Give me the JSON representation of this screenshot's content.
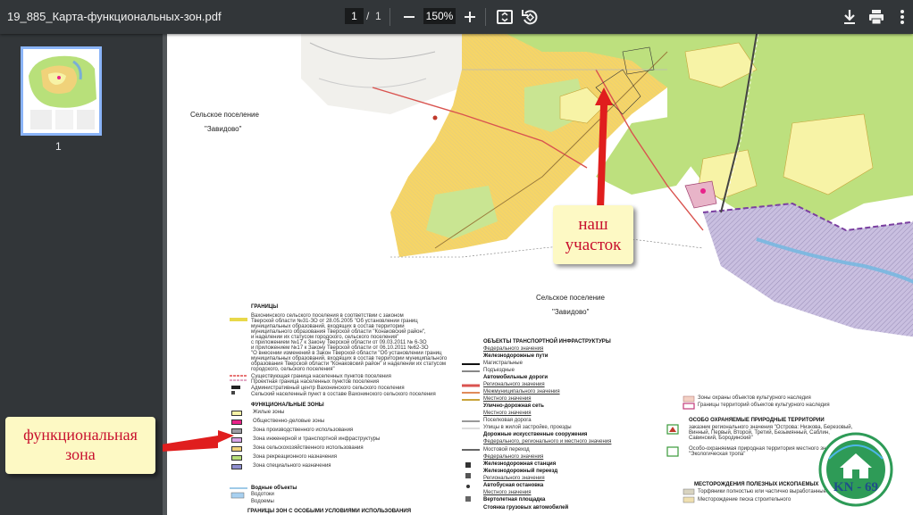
{
  "toolbar": {
    "title": "19_885_Карта-функциональных-зон.pdf",
    "page_current": "1",
    "page_separator": "/",
    "page_total": "1",
    "zoom": "150%"
  },
  "sidebar": {
    "thumb_page_number": "1"
  },
  "map": {
    "settlement_1_line1": "Сельское поселение",
    "settlement_1_line2": "\"Завидово\"",
    "settlement_2_line1": "Сельское поселение",
    "settlement_2_line2": "\"Завидово\""
  },
  "legend_left": {
    "granitsy_title": "ГРАНИЦЫ",
    "granitsy_text_1": "Вахонинского сельского поселения в соответствии с законом",
    "granitsy_text_2": "Тверской области №31-ЗО от 28.05.2005 \"Об установлении границ",
    "granitsy_text_3": "муниципальных образований, входящих в состав территории",
    "granitsy_text_4": "муниципального образования Тверской области \"Конаковский район\",",
    "granitsy_text_5": "и наделении их статусом городского, сельского поселения\"",
    "granitsy_text_6": "с приложением №17 к Закону Тверской области от 09.03.2011 № 6-ЗО",
    "granitsy_text_7": "и приложением №17 к Закону Тверской области от 06.10.2011 №62-ЗО",
    "granitsy_text_8": "\"О внесении изменений в Закон Тверской области \"Об установлении границ",
    "granitsy_text_9": "муниципальных образований, входящих в состав территории муниципального",
    "granitsy_text_10": "образования Тверской области \"Конаковский район\" и наделении их статусом",
    "granitsy_text_11": "городского, сельского поселения\"",
    "existing_border": "Существующая граница населенных пунктов поселения",
    "project_border": "Проектная граница населенных пунктов поселения",
    "admin_center": "Административный центр Вахонинского сельского поселения",
    "rural_settlement": "Сельский населенный пункт в составе Вахонинского сельского поселения",
    "zones_title": "ФУНКЦИОНАЛЬНЫЕ ЗОНЫ",
    "zones": [
      {
        "label": "Жилые зоны",
        "color": "#f7f3a6"
      },
      {
        "label": "Общественно-деловые зоны",
        "color": "#e8238a"
      },
      {
        "label": "Зона производственного использования",
        "color": "#9b9ba3"
      },
      {
        "label": "Зона инженерной и транспортной инфраструктуры",
        "color": "#d9a3e6"
      },
      {
        "label": "Зона сельскохозяйственного использования",
        "color": "#f0d27a"
      },
      {
        "label": "Зона рекреационного назначения",
        "color": "#b8e07a"
      },
      {
        "label": "Зона специального назначения",
        "color": "#8f8fd0"
      }
    ],
    "water_title": "Водные объекты",
    "water_1": "Водотоки",
    "water_2": "Водоемы",
    "special_zones_title": "ГРАНИЦЫ ЗОН С ОСОБЫМИ УСЛОВИЯМИ ИСПОЛЬЗОВАНИЯ"
  },
  "legend_mid": {
    "title": "ОБЪЕКТЫ ТРАНСПОРТНОЙ ИНФРАСТРУКТУРЫ",
    "federal": "Федерального значения",
    "rail_title": "Железнодорожные пути",
    "main_rail": "Магистральные",
    "access_rail": "Подъездные",
    "roads_title": "Автомобильные дороги",
    "regional": "Регионального значения",
    "intermunicipal": "Межмуниципального значения",
    "local": "Местного значения",
    "street_title": "Улично-дорожная сеть",
    "local2": "Местного значения",
    "main_road": "Поселковая дорога",
    "streets": "Улицы в жилой застройке, проезды",
    "bridges_title": "Дорожные искусственные сооружения",
    "bridges_level": "Федерального, регионального и местного значения",
    "bridge": "Мостовой переход",
    "federal2": "Федерального значения",
    "station": "Железнодорожная станция",
    "crossing": "Железнодорожный переезд",
    "regional2": "Регионального значения",
    "bus": "Автобусная остановка",
    "local3": "Местного значения",
    "heli": "Вертолетная площадка",
    "truck": "Стоянка грузовых автомобилей"
  },
  "legend_right": {
    "heritage_zone": "Зоны охраны объектов культурного наследия",
    "heritage_border": "Границы территорий объектов культурного наследия",
    "protected_title": "ОСОБО ОХРАНЯЕМЫЕ ПРИРОДНЫЕ ТЕРРИТОРИИ",
    "reserve_1": "заказник регионального значения \"Острова: Низкова, Березовый,",
    "reserve_2": "Винный, Первый, Второй, Третий, Безымянный, Саблин,",
    "reserve_3": "Савинский, Бородинский\"",
    "local_protected_1": "Особо-охраняемая природная территория местного значения",
    "local_protected_2": "\"Экологическая тропа\"",
    "deposits_title": "МЕСТОРОЖДЕНИЯ ПОЛЕЗНЫХ ИСКОПАЕМЫХ",
    "peat": "Торфяники полностью или частично выработанные",
    "sand": "Месторождение песка строительного"
  },
  "annotations": {
    "our_plot_line1": "наш",
    "our_plot_line2": "участок",
    "func_zone_line1": "функциональная",
    "func_zone_line2": "зона",
    "logo_text": "KN - 69"
  },
  "colors": {
    "toolbar_bg": "#323639",
    "viewer_bg": "#525659",
    "callout_bg": "#fdf9c4",
    "callout_text": "#c8102e",
    "arrow_red": "#e01e1e",
    "logo_green": "#2e9b57"
  }
}
